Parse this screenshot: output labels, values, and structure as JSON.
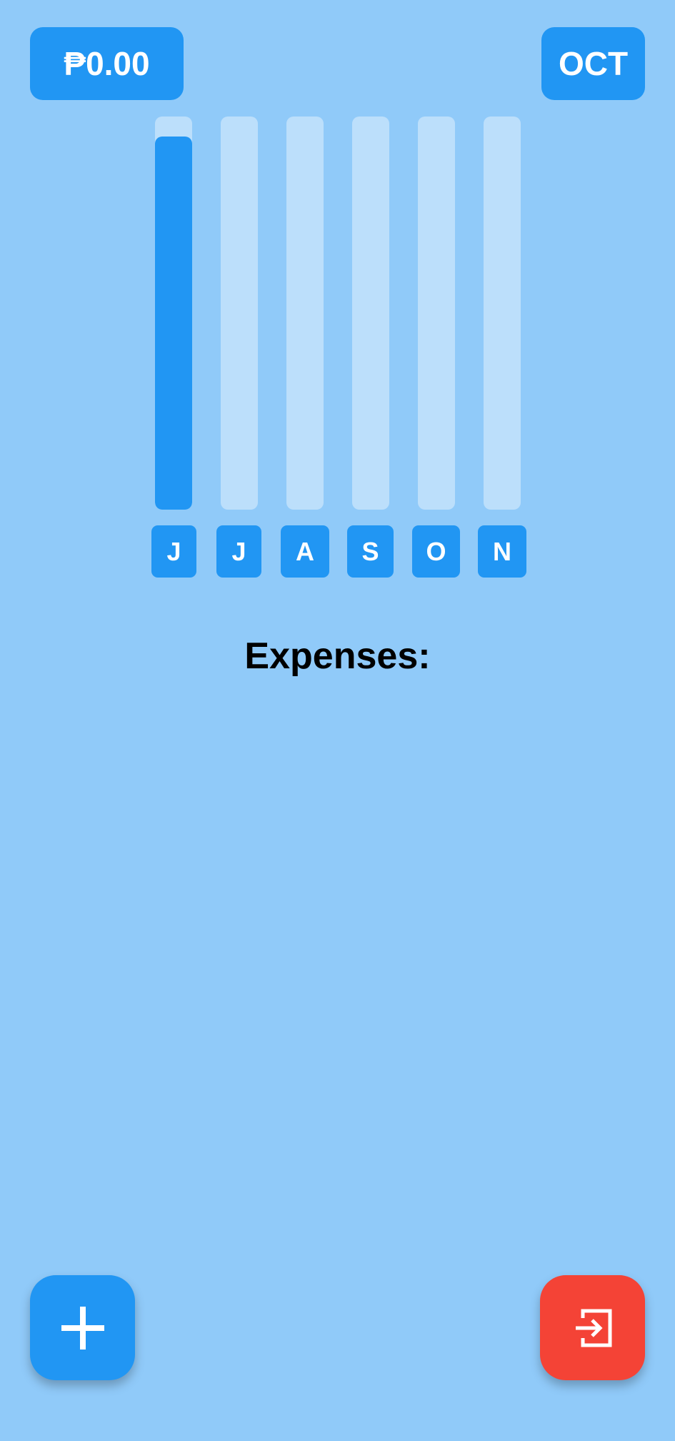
{
  "header": {
    "balance": "₱0.00",
    "selected_month": "OCT"
  },
  "chart_data": {
    "type": "bar",
    "categories": [
      "J",
      "J",
      "A",
      "S",
      "O",
      "N"
    ],
    "values": [
      0.95,
      0,
      0,
      0,
      0,
      0
    ],
    "ylim": [
      0,
      1
    ]
  },
  "expenses": {
    "title": "Expenses:"
  },
  "actions": {
    "add_icon": "plus-icon",
    "exit_icon": "exit-icon"
  },
  "colors": {
    "background": "#90CAF9",
    "accent": "#2196F3",
    "track": "rgba(255,255,255,0.40)",
    "danger": "#F44336"
  }
}
